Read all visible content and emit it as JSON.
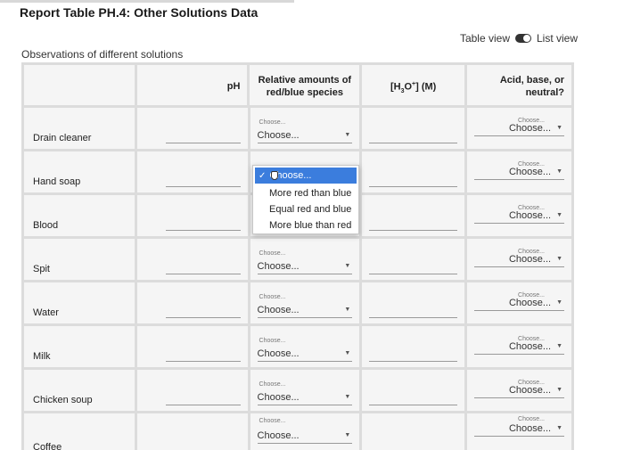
{
  "header": {
    "title": "Report Table PH.4: Other Solutions Data",
    "view_table": "Table view",
    "view_list": "List view"
  },
  "section": {
    "caption": "Observations of different solutions"
  },
  "table": {
    "columns": {
      "ph": "pH",
      "relative": "Relative amounts of red/blue species",
      "h3o": "[H3O+] (M)",
      "acid": "Acid, base, or neutral?"
    },
    "mini_label": "Choose...",
    "choose": "Choose...",
    "rows": [
      {
        "name": "Drain cleaner"
      },
      {
        "name": "Hand soap"
      },
      {
        "name": "Blood"
      },
      {
        "name": "Spit"
      },
      {
        "name": "Water"
      },
      {
        "name": "Milk"
      },
      {
        "name": "Chicken soup"
      },
      {
        "name": "Coffee"
      }
    ]
  },
  "dropdown": {
    "selected": "Choose...",
    "options": [
      "More red than blue",
      "Equal red and blue",
      "More blue than red"
    ]
  }
}
